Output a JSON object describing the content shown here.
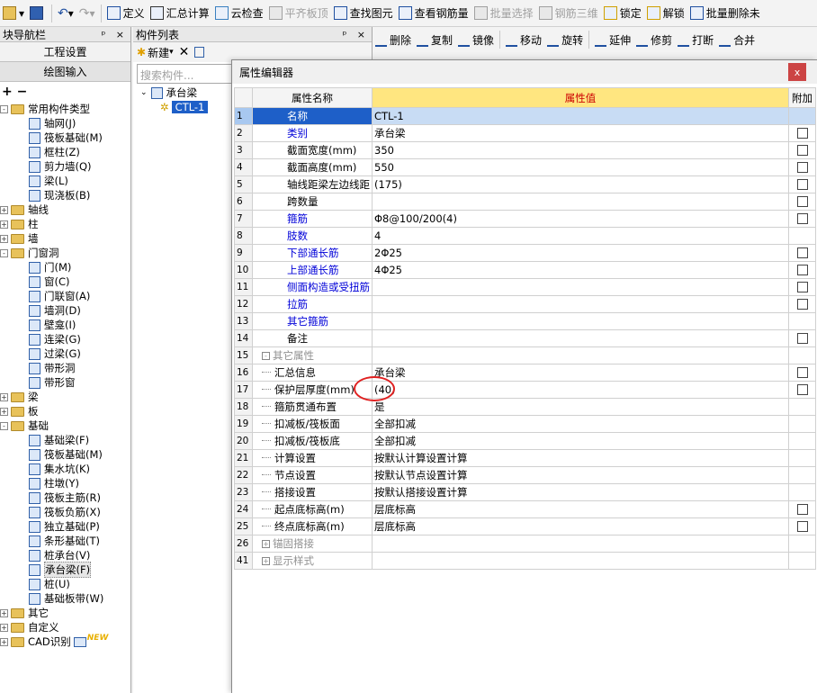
{
  "toolbar": {
    "items": [
      "定义",
      "汇总计算",
      "云检查",
      "平齐板顶",
      "查找图元",
      "查看钢筋量",
      "批量选择",
      "钢筋三维",
      "锁定",
      "解锁",
      "批量删除未"
    ]
  },
  "toolbar2": {
    "items": [
      "删除",
      "复制",
      "镜像",
      "移动",
      "旋转",
      "延伸",
      "修剪",
      "打断",
      "合并"
    ]
  },
  "nav": {
    "title": "块导航栏",
    "pin": "ᵖ ×",
    "btn1": "工程设置",
    "btn2": "绘图输入",
    "tool": "+ −",
    "tree": [
      {
        "label": "常用构件类型",
        "lvl": 0,
        "type": "fold",
        "exp": "-"
      },
      {
        "label": "轴网(J)",
        "lvl": 1
      },
      {
        "label": "筏板基础(M)",
        "lvl": 1
      },
      {
        "label": "框柱(Z)",
        "lvl": 1
      },
      {
        "label": "剪力墙(Q)",
        "lvl": 1
      },
      {
        "label": "梁(L)",
        "lvl": 1
      },
      {
        "label": "现浇板(B)",
        "lvl": 1
      },
      {
        "label": "轴线",
        "lvl": 0,
        "type": "fold",
        "exp": "+"
      },
      {
        "label": "柱",
        "lvl": 0,
        "type": "fold",
        "exp": "+"
      },
      {
        "label": "墙",
        "lvl": 0,
        "type": "fold",
        "exp": "+"
      },
      {
        "label": "门窗洞",
        "lvl": 0,
        "type": "fold",
        "exp": "-"
      },
      {
        "label": "门(M)",
        "lvl": 1
      },
      {
        "label": "窗(C)",
        "lvl": 1
      },
      {
        "label": "门联窗(A)",
        "lvl": 1
      },
      {
        "label": "墙洞(D)",
        "lvl": 1
      },
      {
        "label": "壁龛(I)",
        "lvl": 1
      },
      {
        "label": "连梁(G)",
        "lvl": 1
      },
      {
        "label": "过梁(G)",
        "lvl": 1
      },
      {
        "label": "带形洞",
        "lvl": 1
      },
      {
        "label": "带形窗",
        "lvl": 1
      },
      {
        "label": "梁",
        "lvl": 0,
        "type": "fold",
        "exp": "+"
      },
      {
        "label": "板",
        "lvl": 0,
        "type": "fold",
        "exp": "+"
      },
      {
        "label": "基础",
        "lvl": 0,
        "type": "fold",
        "exp": "-"
      },
      {
        "label": "基础梁(F)",
        "lvl": 1
      },
      {
        "label": "筏板基础(M)",
        "lvl": 1
      },
      {
        "label": "集水坑(K)",
        "lvl": 1
      },
      {
        "label": "柱墩(Y)",
        "lvl": 1
      },
      {
        "label": "筏板主筋(R)",
        "lvl": 1
      },
      {
        "label": "筏板负筋(X)",
        "lvl": 1
      },
      {
        "label": "独立基础(P)",
        "lvl": 1
      },
      {
        "label": "条形基础(T)",
        "lvl": 1
      },
      {
        "label": "桩承台(V)",
        "lvl": 1
      },
      {
        "label": "承台梁(F)",
        "lvl": 1,
        "sel": true
      },
      {
        "label": "桩(U)",
        "lvl": 1
      },
      {
        "label": "基础板带(W)",
        "lvl": 1
      },
      {
        "label": "其它",
        "lvl": 0,
        "type": "fold",
        "exp": "+"
      },
      {
        "label": "自定义",
        "lvl": 0,
        "type": "fold",
        "exp": "+"
      },
      {
        "label": "CAD识别",
        "lvl": 0,
        "type": "fold",
        "exp": "+",
        "badge": "NEW"
      }
    ]
  },
  "comp": {
    "title": "构件列表",
    "pin": "ᵖ ×",
    "new_label": "新建",
    "search_placeholder": "搜索构件...",
    "root": "承台梁",
    "child": "CTL-1"
  },
  "dialog": {
    "title": "属性编辑器",
    "close": "x",
    "headers": {
      "name": "属性名称",
      "value": "属性值",
      "add": "附加"
    },
    "rows": [
      {
        "num": "1",
        "name": "名称",
        "value": "CTL-1",
        "color": "blue",
        "cb": false,
        "sel": true
      },
      {
        "num": "2",
        "name": "类别",
        "value": "承台梁",
        "color": "blue",
        "cb": true
      },
      {
        "num": "3",
        "name": "截面宽度(mm)",
        "value": "350",
        "color": "",
        "cb": true
      },
      {
        "num": "4",
        "name": "截面高度(mm)",
        "value": "550",
        "color": "",
        "cb": true
      },
      {
        "num": "5",
        "name": "轴线距梁左边线距",
        "value": "(175)",
        "color": "",
        "cb": true
      },
      {
        "num": "6",
        "name": "跨数量",
        "value": "",
        "color": "",
        "cb": true
      },
      {
        "num": "7",
        "name": "箍筋",
        "value": "Φ8@100/200(4)",
        "color": "blue",
        "cb": true
      },
      {
        "num": "8",
        "name": "肢数",
        "value": "4",
        "color": "blue",
        "cb": false
      },
      {
        "num": "9",
        "name": "下部通长筋",
        "value": "2Φ25",
        "color": "blue",
        "cb": true
      },
      {
        "num": "10",
        "name": "上部通长筋",
        "value": "4Φ25",
        "color": "blue",
        "cb": true
      },
      {
        "num": "11",
        "name": "侧面构造或受扭筋",
        "value": "",
        "color": "blue",
        "cb": true
      },
      {
        "num": "12",
        "name": "拉筋",
        "value": "",
        "color": "blue",
        "cb": true
      },
      {
        "num": "13",
        "name": "其它箍筋",
        "value": "",
        "color": "blue",
        "cb": false
      },
      {
        "num": "14",
        "name": "备注",
        "value": "",
        "color": "",
        "cb": true
      },
      {
        "num": "15",
        "name": "其它属性",
        "value": "",
        "color": "grey",
        "group": "-",
        "cb": false
      },
      {
        "num": "16",
        "name": "汇总信息",
        "value": "承台梁",
        "color": "",
        "sub": true,
        "cb": true
      },
      {
        "num": "17",
        "name": "保护层厚度(mm)",
        "value": "(40)",
        "color": "",
        "sub": true,
        "cb": true
      },
      {
        "num": "18",
        "name": "箍筋贯通布置",
        "value": "是",
        "color": "",
        "sub": true,
        "cb": false
      },
      {
        "num": "19",
        "name": "扣减板/筏板面",
        "value": "全部扣减",
        "color": "",
        "sub": true,
        "cb": false
      },
      {
        "num": "20",
        "name": "扣减板/筏板底",
        "value": "全部扣减",
        "color": "",
        "sub": true,
        "cb": false
      },
      {
        "num": "21",
        "name": "计算设置",
        "value": "按默认计算设置计算",
        "color": "",
        "sub": true,
        "cb": false
      },
      {
        "num": "22",
        "name": "节点设置",
        "value": "按默认节点设置计算",
        "color": "",
        "sub": true,
        "cb": false
      },
      {
        "num": "23",
        "name": "搭接设置",
        "value": "按默认搭接设置计算",
        "color": "",
        "sub": true,
        "cb": false
      },
      {
        "num": "24",
        "name": "起点底标高(m)",
        "value": "层底标高",
        "color": "",
        "sub": true,
        "cb": true
      },
      {
        "num": "25",
        "name": "终点底标高(m)",
        "value": "层底标高",
        "color": "",
        "sub": true,
        "cb": true
      },
      {
        "num": "26",
        "name": "锚固搭接",
        "value": "",
        "color": "grey",
        "group": "+",
        "cb": false
      },
      {
        "num": "41",
        "name": "显示样式",
        "value": "",
        "color": "grey",
        "group": "+",
        "cb": false
      }
    ]
  }
}
